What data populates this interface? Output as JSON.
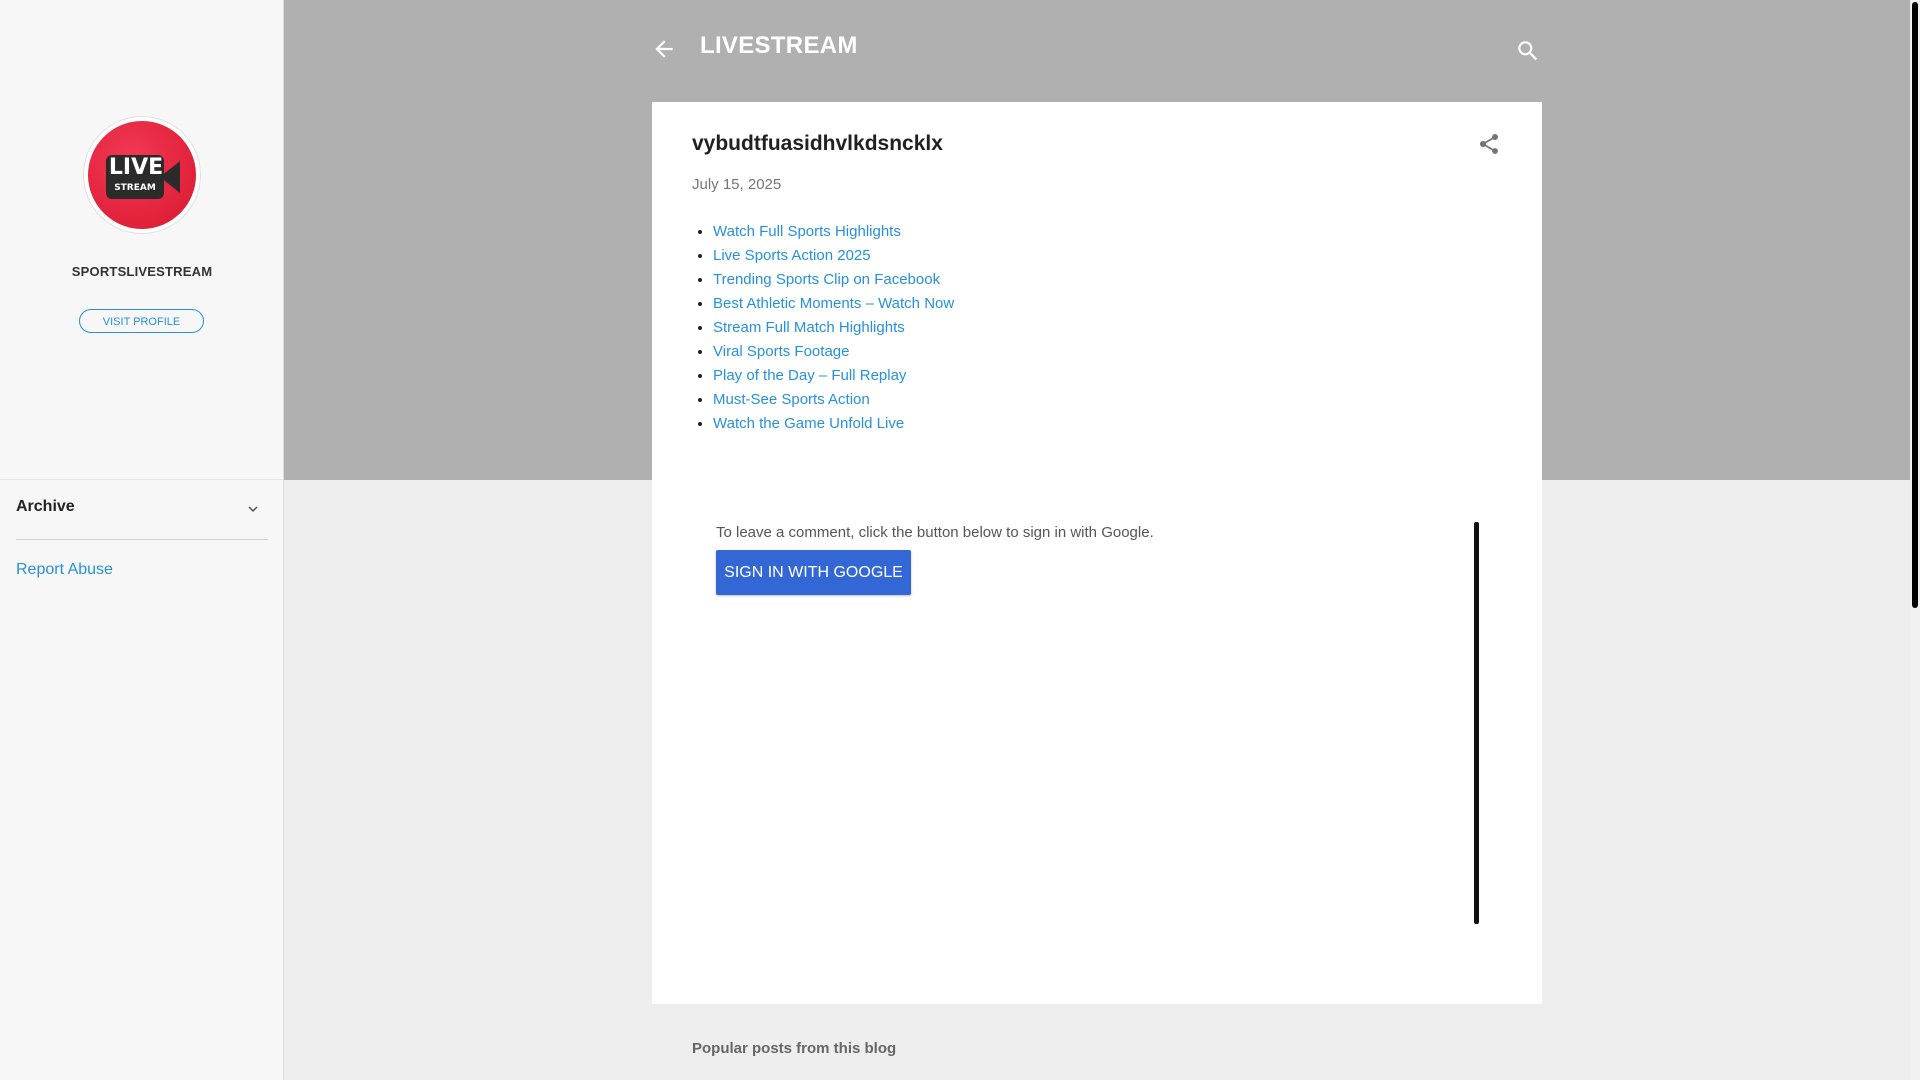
{
  "sidebar": {
    "profile_name": "SPORTSLIVESTREAM",
    "logo_text_big": "LIVE",
    "logo_text_small": "STREAM",
    "visit_profile_label": "VISIT PROFILE",
    "archive_label": "Archive",
    "report_abuse_label": "Report Abuse"
  },
  "header": {
    "site_title": "LIVESTREAM"
  },
  "post": {
    "title": "vybudtfuasidhvlkdsncklx",
    "date": "July 15, 2025",
    "links": [
      "Watch Full Sports Highlights",
      "Live Sports Action 2025",
      "Trending Sports Clip on Facebook",
      "Best Athletic Moments – Watch Now",
      "Stream Full Match Highlights",
      "Viral Sports Footage",
      "Play of the Day – Full Replay",
      "Must-See Sports Action",
      "Watch the Game Unfold Live"
    ]
  },
  "comments": {
    "prompt": "To leave a comment, click the button below to sign in with Google.",
    "sign_in_label": "SIGN IN WITH GOOGLE"
  },
  "footer": {
    "popular_heading": "Popular posts from this blog"
  },
  "icons": {
    "back": "arrow-left-icon",
    "search": "search-icon",
    "share": "share-icon",
    "chevron": "chevron-down-icon"
  },
  "colors": {
    "header_band": "#b0b0b0",
    "link": "#2a8fd9",
    "sign_in_button": "#3367d6",
    "avatar_red": "#d9172e"
  }
}
